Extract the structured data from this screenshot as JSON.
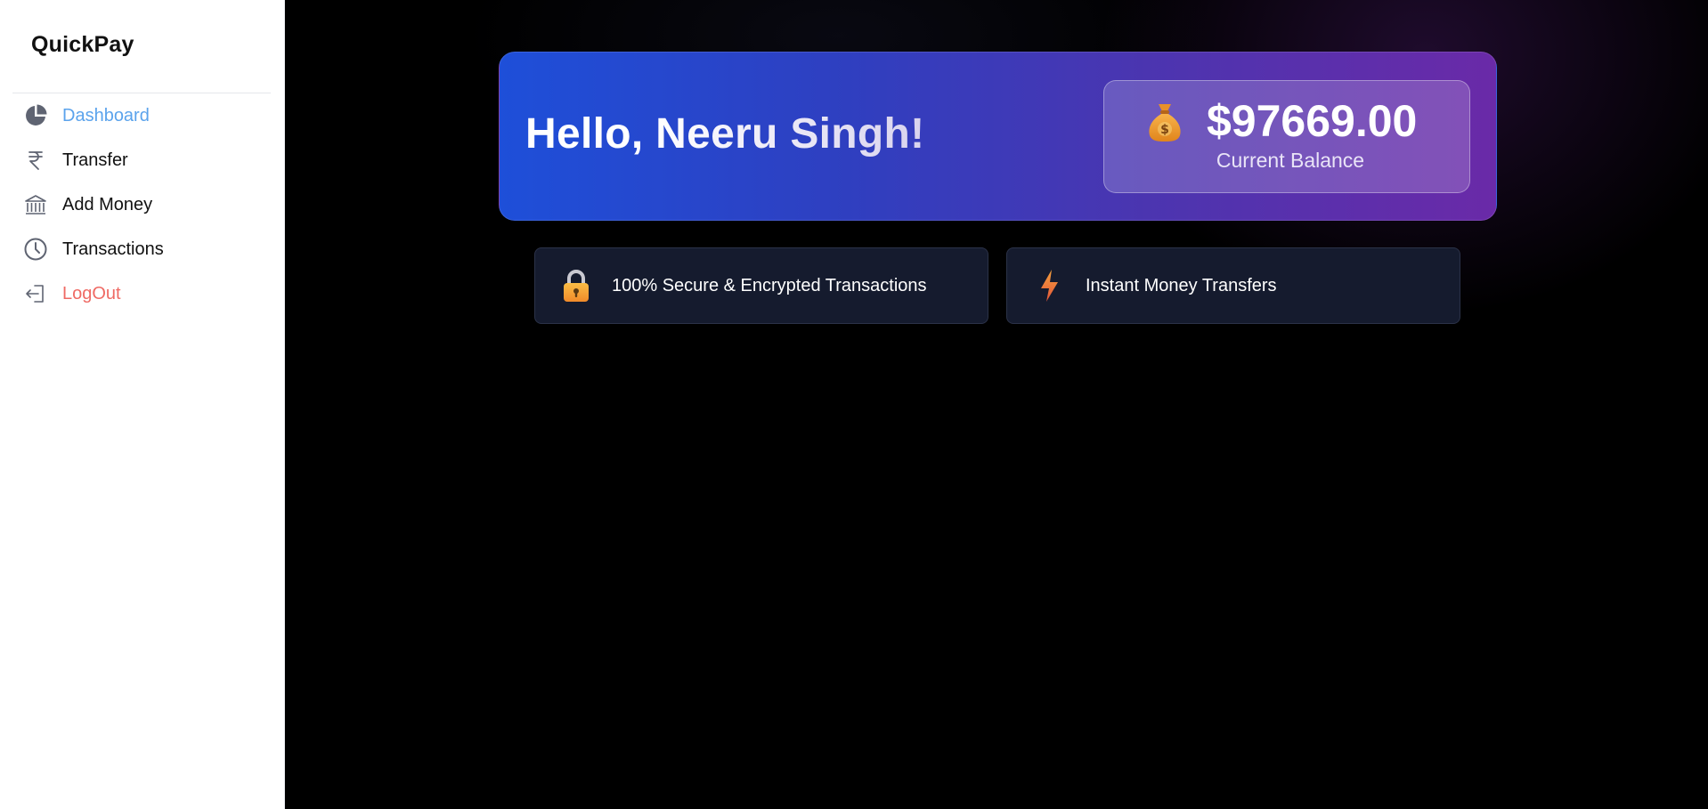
{
  "sidebar": {
    "brand": "QuickPay",
    "items": [
      {
        "label": "Dashboard",
        "icon": "pie-chart-icon",
        "active": true
      },
      {
        "label": "Transfer",
        "icon": "rupee-icon"
      },
      {
        "label": "Add Money",
        "icon": "bank-icon"
      },
      {
        "label": "Transactions",
        "icon": "clock-icon"
      },
      {
        "label": "LogOut",
        "icon": "logout-icon"
      }
    ]
  },
  "hero": {
    "greeting_prefix": "Hello, ",
    "user_name": "Neeru Singh!",
    "balance": {
      "icon": "money-bag-icon",
      "amount": "$97669.00",
      "label": "Current Balance"
    }
  },
  "features": [
    {
      "label": "100% Secure & Encrypted Transactions",
      "icon": "lock-icon"
    },
    {
      "label": "Instant Money Transfers",
      "icon": "lightning-icon"
    }
  ],
  "colors": {
    "active_nav": "#5ba3ec",
    "logout": "#ef6a64",
    "hero_gradient_start": "#1e4fd9",
    "hero_gradient_end": "#6a2aa8",
    "feature_card_bg": "#151b2e"
  }
}
